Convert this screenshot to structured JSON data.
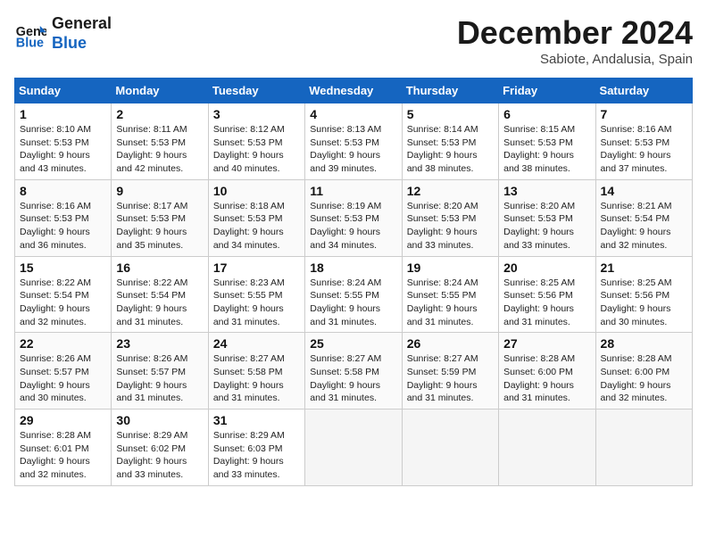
{
  "logo": {
    "line1": "General",
    "line2": "Blue"
  },
  "title": "December 2024",
  "subtitle": "Sabiote, Andalusia, Spain",
  "weekdays": [
    "Sunday",
    "Monday",
    "Tuesday",
    "Wednesday",
    "Thursday",
    "Friday",
    "Saturday"
  ],
  "weeks": [
    [
      {
        "day": "1",
        "info": "Sunrise: 8:10 AM\nSunset: 5:53 PM\nDaylight: 9 hours\nand 43 minutes."
      },
      {
        "day": "2",
        "info": "Sunrise: 8:11 AM\nSunset: 5:53 PM\nDaylight: 9 hours\nand 42 minutes."
      },
      {
        "day": "3",
        "info": "Sunrise: 8:12 AM\nSunset: 5:53 PM\nDaylight: 9 hours\nand 40 minutes."
      },
      {
        "day": "4",
        "info": "Sunrise: 8:13 AM\nSunset: 5:53 PM\nDaylight: 9 hours\nand 39 minutes."
      },
      {
        "day": "5",
        "info": "Sunrise: 8:14 AM\nSunset: 5:53 PM\nDaylight: 9 hours\nand 38 minutes."
      },
      {
        "day": "6",
        "info": "Sunrise: 8:15 AM\nSunset: 5:53 PM\nDaylight: 9 hours\nand 38 minutes."
      },
      {
        "day": "7",
        "info": "Sunrise: 8:16 AM\nSunset: 5:53 PM\nDaylight: 9 hours\nand 37 minutes."
      }
    ],
    [
      {
        "day": "8",
        "info": "Sunrise: 8:16 AM\nSunset: 5:53 PM\nDaylight: 9 hours\nand 36 minutes."
      },
      {
        "day": "9",
        "info": "Sunrise: 8:17 AM\nSunset: 5:53 PM\nDaylight: 9 hours\nand 35 minutes."
      },
      {
        "day": "10",
        "info": "Sunrise: 8:18 AM\nSunset: 5:53 PM\nDaylight: 9 hours\nand 34 minutes."
      },
      {
        "day": "11",
        "info": "Sunrise: 8:19 AM\nSunset: 5:53 PM\nDaylight: 9 hours\nand 34 minutes."
      },
      {
        "day": "12",
        "info": "Sunrise: 8:20 AM\nSunset: 5:53 PM\nDaylight: 9 hours\nand 33 minutes."
      },
      {
        "day": "13",
        "info": "Sunrise: 8:20 AM\nSunset: 5:53 PM\nDaylight: 9 hours\nand 33 minutes."
      },
      {
        "day": "14",
        "info": "Sunrise: 8:21 AM\nSunset: 5:54 PM\nDaylight: 9 hours\nand 32 minutes."
      }
    ],
    [
      {
        "day": "15",
        "info": "Sunrise: 8:22 AM\nSunset: 5:54 PM\nDaylight: 9 hours\nand 32 minutes."
      },
      {
        "day": "16",
        "info": "Sunrise: 8:22 AM\nSunset: 5:54 PM\nDaylight: 9 hours\nand 31 minutes."
      },
      {
        "day": "17",
        "info": "Sunrise: 8:23 AM\nSunset: 5:55 PM\nDaylight: 9 hours\nand 31 minutes."
      },
      {
        "day": "18",
        "info": "Sunrise: 8:24 AM\nSunset: 5:55 PM\nDaylight: 9 hours\nand 31 minutes."
      },
      {
        "day": "19",
        "info": "Sunrise: 8:24 AM\nSunset: 5:55 PM\nDaylight: 9 hours\nand 31 minutes."
      },
      {
        "day": "20",
        "info": "Sunrise: 8:25 AM\nSunset: 5:56 PM\nDaylight: 9 hours\nand 31 minutes."
      },
      {
        "day": "21",
        "info": "Sunrise: 8:25 AM\nSunset: 5:56 PM\nDaylight: 9 hours\nand 30 minutes."
      }
    ],
    [
      {
        "day": "22",
        "info": "Sunrise: 8:26 AM\nSunset: 5:57 PM\nDaylight: 9 hours\nand 30 minutes."
      },
      {
        "day": "23",
        "info": "Sunrise: 8:26 AM\nSunset: 5:57 PM\nDaylight: 9 hours\nand 31 minutes."
      },
      {
        "day": "24",
        "info": "Sunrise: 8:27 AM\nSunset: 5:58 PM\nDaylight: 9 hours\nand 31 minutes."
      },
      {
        "day": "25",
        "info": "Sunrise: 8:27 AM\nSunset: 5:58 PM\nDaylight: 9 hours\nand 31 minutes."
      },
      {
        "day": "26",
        "info": "Sunrise: 8:27 AM\nSunset: 5:59 PM\nDaylight: 9 hours\nand 31 minutes."
      },
      {
        "day": "27",
        "info": "Sunrise: 8:28 AM\nSunset: 6:00 PM\nDaylight: 9 hours\nand 31 minutes."
      },
      {
        "day": "28",
        "info": "Sunrise: 8:28 AM\nSunset: 6:00 PM\nDaylight: 9 hours\nand 32 minutes."
      }
    ],
    [
      {
        "day": "29",
        "info": "Sunrise: 8:28 AM\nSunset: 6:01 PM\nDaylight: 9 hours\nand 32 minutes."
      },
      {
        "day": "30",
        "info": "Sunrise: 8:29 AM\nSunset: 6:02 PM\nDaylight: 9 hours\nand 33 minutes."
      },
      {
        "day": "31",
        "info": "Sunrise: 8:29 AM\nSunset: 6:03 PM\nDaylight: 9 hours\nand 33 minutes."
      },
      {
        "day": "",
        "info": ""
      },
      {
        "day": "",
        "info": ""
      },
      {
        "day": "",
        "info": ""
      },
      {
        "day": "",
        "info": ""
      }
    ]
  ]
}
